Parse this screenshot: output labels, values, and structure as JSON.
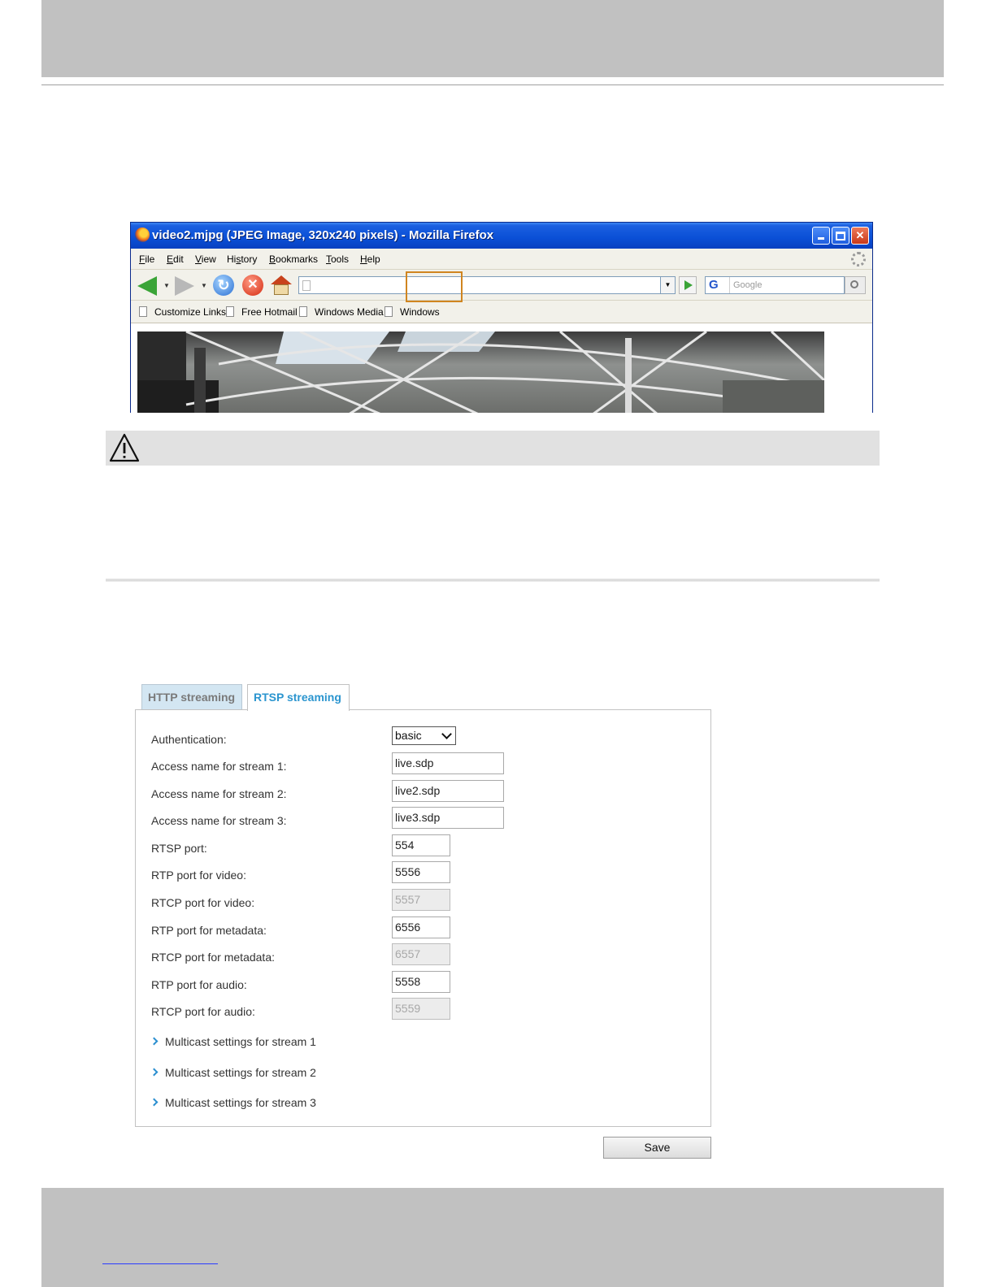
{
  "browser": {
    "title": "video2.mjpg (JPEG Image, 320x240 pixels) - Mozilla Firefox",
    "menu": {
      "file": {
        "u": "F",
        "rest": "ile"
      },
      "edit": {
        "u": "E",
        "rest": "dit"
      },
      "view": {
        "u": "V",
        "rest": "iew"
      },
      "history": {
        "pre": "Hi",
        "u": "s",
        "rest": "tory"
      },
      "bookmarks": {
        "u": "B",
        "rest": "ookmarks"
      },
      "tools": {
        "u": "T",
        "rest": "ools"
      },
      "help": {
        "u": "H",
        "rest": "elp"
      }
    },
    "search_placeholder": "Google",
    "search_engine_letter": "G",
    "bookmarks": [
      "Customize Links",
      "Free Hotmail",
      "Windows Media",
      "Windows"
    ]
  },
  "tabs": {
    "http": "HTTP streaming",
    "rtsp": "RTSP streaming"
  },
  "form": {
    "authentication": {
      "label": "Authentication:",
      "value": "basic"
    },
    "stream1": {
      "label": "Access name for stream 1:",
      "value": "live.sdp"
    },
    "stream2": {
      "label": "Access name for stream 2:",
      "value": "live2.sdp"
    },
    "stream3": {
      "label": "Access name for stream 3:",
      "value": "live3.sdp"
    },
    "rtsp_port": {
      "label": "RTSP port:",
      "value": "554"
    },
    "rtp_video": {
      "label": "RTP port for video:",
      "value": "5556"
    },
    "rtcp_video": {
      "label": "RTCP port for video:",
      "value": "5557"
    },
    "rtp_metadata": {
      "label": "RTP port for metadata:",
      "value": "6556"
    },
    "rtcp_metadata": {
      "label": "RTCP port for metadata:",
      "value": "6557"
    },
    "rtp_audio": {
      "label": "RTP port for audio:",
      "value": "5558"
    },
    "rtcp_audio": {
      "label": "RTCP port for audio:",
      "value": "5559"
    },
    "multicast": [
      "Multicast settings for stream 1",
      "Multicast settings for stream 2",
      "Multicast settings for stream 3"
    ],
    "save": "Save"
  },
  "colors": {
    "band_gray": "#c1c1c1",
    "tab_active_text": "#2b95cf",
    "highlight_box": "#d08520"
  }
}
